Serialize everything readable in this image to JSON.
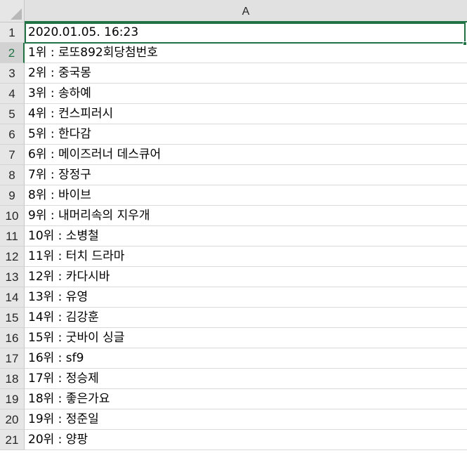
{
  "sheet": {
    "column_header": "A",
    "rows": [
      {
        "num": "1",
        "value": "2020.01.05. 16:23"
      },
      {
        "num": "2",
        "value": "1위 : 로또892회당첨번호"
      },
      {
        "num": "3",
        "value": "2위 : 중국몽"
      },
      {
        "num": "4",
        "value": "3위 : 송하예"
      },
      {
        "num": "5",
        "value": "4위 : 컨스피러시"
      },
      {
        "num": "6",
        "value": "5위 : 한다감"
      },
      {
        "num": "7",
        "value": "6위 : 메이즈러너 데스큐어"
      },
      {
        "num": "8",
        "value": "7위 : 장정구"
      },
      {
        "num": "9",
        "value": "8위 : 바이브"
      },
      {
        "num": "10",
        "value": "9위 : 내머리속의 지우개"
      },
      {
        "num": "11",
        "value": "10위 : 소병철"
      },
      {
        "num": "12",
        "value": "11위 : 터치 드라마"
      },
      {
        "num": "13",
        "value": "12위 : 카다시바"
      },
      {
        "num": "14",
        "value": "13위 : 유영"
      },
      {
        "num": "15",
        "value": "14위 : 김강훈"
      },
      {
        "num": "16",
        "value": "15위 : 굿바이 싱글"
      },
      {
        "num": "17",
        "value": "16위 : sf9"
      },
      {
        "num": "18",
        "value": "17위 : 정승제"
      },
      {
        "num": "19",
        "value": "18위 : 좋은가요"
      },
      {
        "num": "20",
        "value": "19위 : 정준일"
      },
      {
        "num": "21",
        "value": "20위 : 양팡"
      }
    ]
  },
  "colors": {
    "accent": "#217346",
    "header_bg": "#e6e6e6",
    "gridline": "#d9d9d9"
  }
}
